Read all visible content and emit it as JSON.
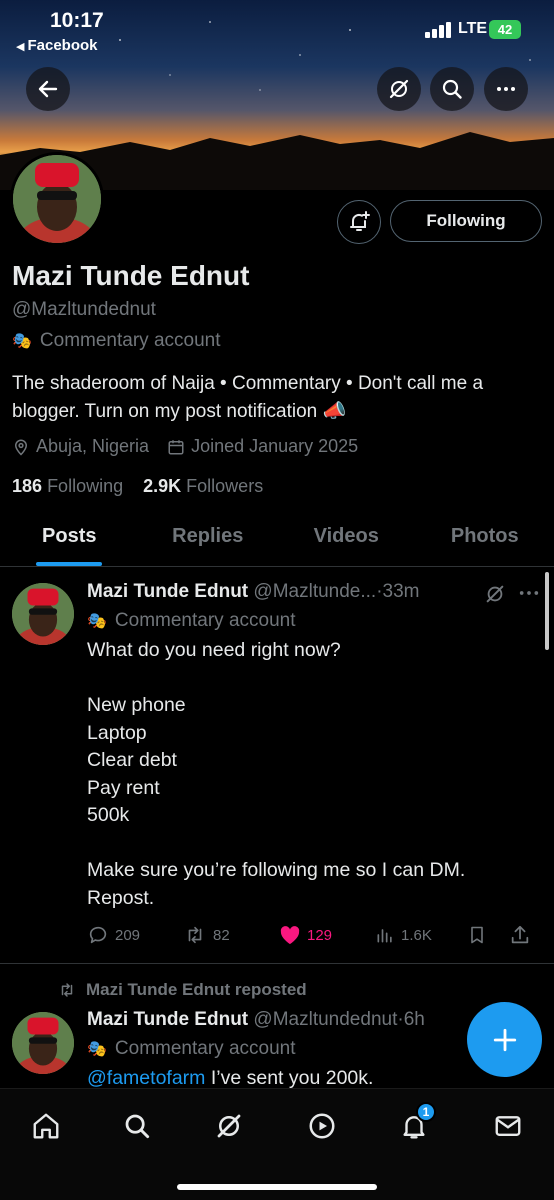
{
  "status_bar": {
    "time": "10:17",
    "back_app": "Facebook",
    "network": "LTE",
    "battery": "42"
  },
  "header": {
    "back_icon": "arrow-left-icon",
    "actions": [
      "grok-icon",
      "search-icon",
      "more-icon"
    ]
  },
  "profile": {
    "display_name": "Mazi Tunde Ednut",
    "handle": "@Mazltundednut",
    "label": "Commentary account",
    "bio": "The shaderoom of Naija • Commentary • Don't call me a blogger. Turn on my post notification 📣",
    "location": "Abuja, Nigeria",
    "joined": "Joined January 2025",
    "following_count": "186",
    "following_label": "Following",
    "followers_count": "2.9K",
    "followers_label": "Followers",
    "follow_button": "Following"
  },
  "tabs": [
    {
      "label": "Posts",
      "active": true
    },
    {
      "label": "Replies",
      "active": false
    },
    {
      "label": "Videos",
      "active": false
    },
    {
      "label": "Photos",
      "active": false
    }
  ],
  "posts": [
    {
      "name": "Mazi Tunde Ednut",
      "handle": "@Mazltunde...",
      "time": "33m",
      "label": "Commentary account",
      "text": "What do you need right now?\n\nNew phone\nLaptop\nClear debt\nPay rent\n500k\n\nMake sure you’re following me so I can DM.\nRepost.",
      "replies": "209",
      "reposts": "82",
      "likes": "129",
      "views": "1.6K",
      "liked_color": "#f91880"
    },
    {
      "repost_context": "Mazi Tunde Ednut reposted",
      "name": "Mazi Tunde Ednut",
      "handle": "@Mazltundednut",
      "time": "6h",
      "label": "Commentary account",
      "mention": "@fametofarm",
      "text": " I’ve sent you 200k."
    }
  ],
  "bottom_nav": {
    "items": [
      "home-icon",
      "search-icon",
      "grok-icon",
      "play-icon",
      "bell-icon",
      "mail-icon"
    ],
    "notification_badge": "1"
  },
  "colors": {
    "accent": "#1d9bf0",
    "like": "#f91880",
    "muted": "#71767b"
  }
}
